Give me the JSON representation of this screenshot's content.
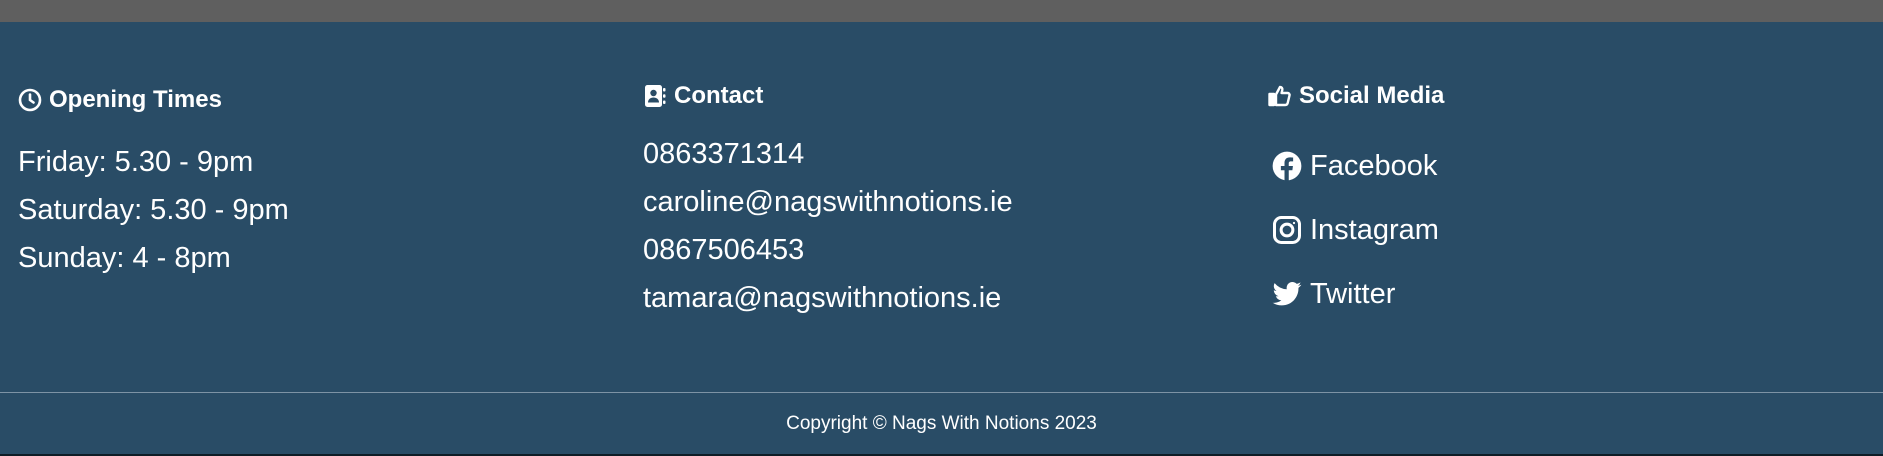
{
  "colors": {
    "footer_bg": "#294c66",
    "top_bar": "#5f5f5f",
    "text": "#ffffff"
  },
  "opening_times": {
    "icon": "clock-icon",
    "title": "Opening Times",
    "lines": [
      "Friday: 5.30 - 9pm",
      "Saturday: 5.30 - 9pm",
      "Sunday: 4 - 8pm"
    ]
  },
  "contact": {
    "icon": "address-book-icon",
    "title": "Contact",
    "lines": [
      "0863371314",
      "caroline@nagswithnotions.ie",
      "0867506453",
      "tamara@nagswithnotions.ie"
    ]
  },
  "social": {
    "icon": "thumbs-up-icon",
    "title": "Social Media",
    "links": [
      {
        "icon": "facebook-icon",
        "label": "Facebook"
      },
      {
        "icon": "instagram-icon",
        "label": "Instagram"
      },
      {
        "icon": "twitter-icon",
        "label": "Twitter"
      }
    ]
  },
  "copyright": "Copyright © Nags With Notions 2023"
}
